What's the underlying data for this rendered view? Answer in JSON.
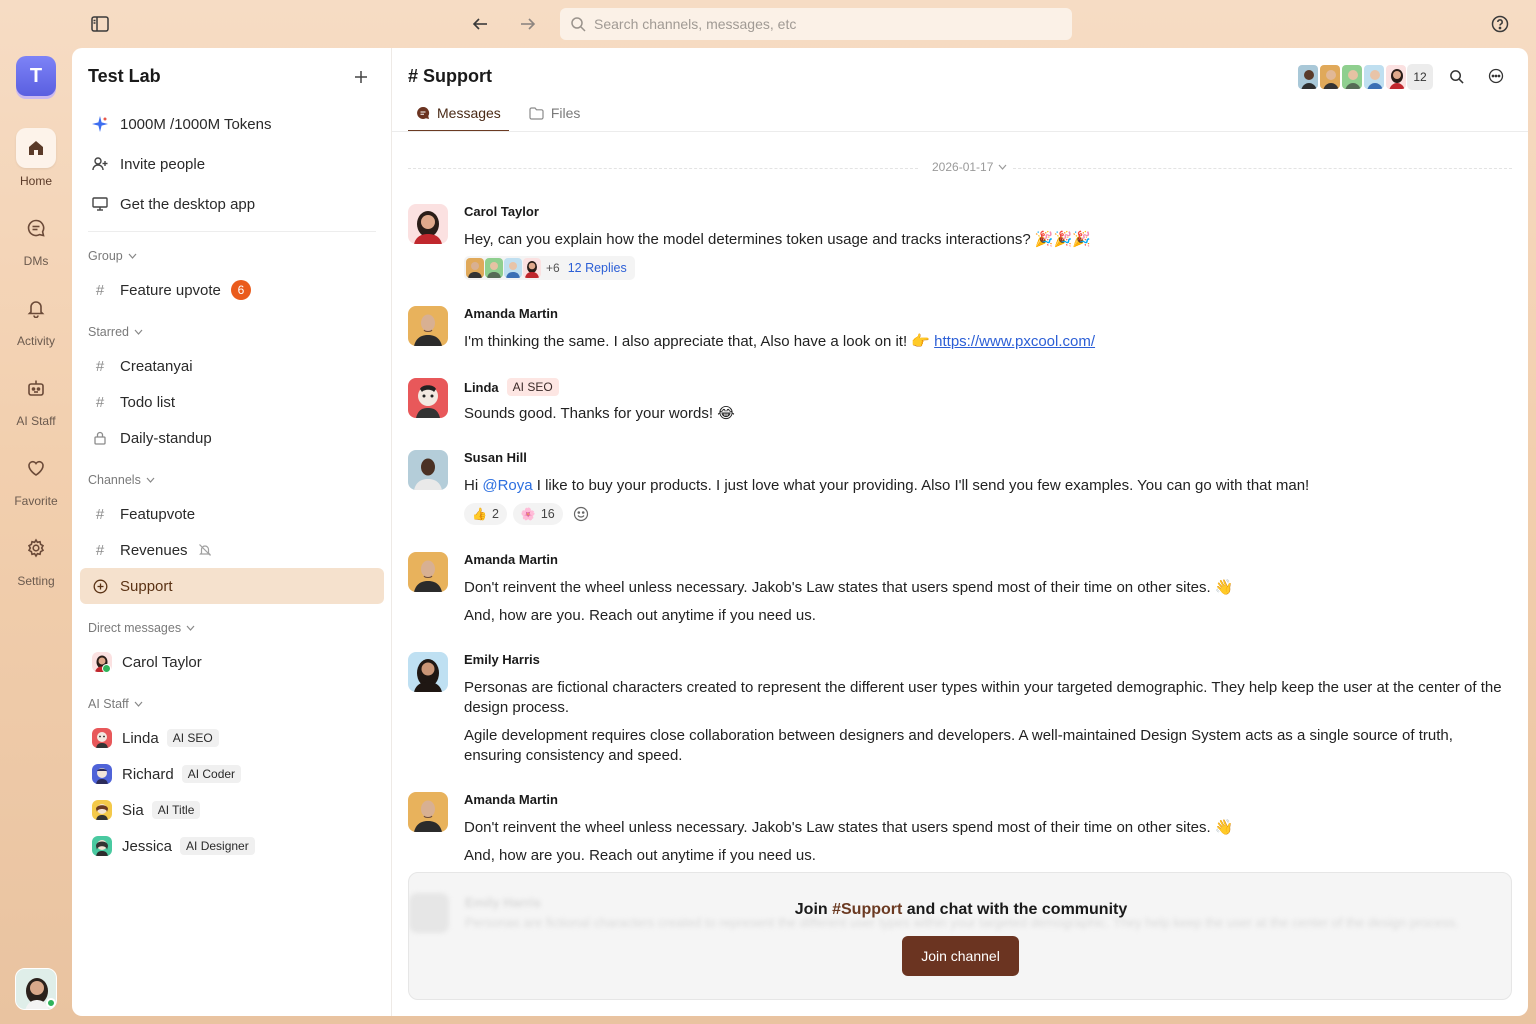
{
  "search": {
    "placeholder": "Search channels, messages, etc"
  },
  "rail": {
    "workspace_initial": "T",
    "items": [
      {
        "label": "Home",
        "icon": "home-icon"
      },
      {
        "label": "DMs",
        "icon": "chat-icon"
      },
      {
        "label": "Activity",
        "icon": "bell-icon"
      },
      {
        "label": "AI Staff",
        "icon": "robot-icon"
      },
      {
        "label": "Favorite",
        "icon": "heart-icon"
      },
      {
        "label": "Setting",
        "icon": "gear-icon"
      }
    ]
  },
  "sidebar": {
    "workspace_name": "Test Lab",
    "quick": [
      {
        "label": "1000M /1000M Tokens",
        "icon": "sparkle-icon"
      },
      {
        "label": "Invite people",
        "icon": "user-plus-icon"
      },
      {
        "label": "Get the desktop app",
        "icon": "monitor-icon"
      }
    ],
    "group_label": "Group",
    "group_items": [
      {
        "label": "Feature upvote",
        "count": "6"
      }
    ],
    "starred_label": "Starred",
    "starred_items": [
      {
        "label": "Creatanyai",
        "icon": "hash-icon"
      },
      {
        "label": "Todo list",
        "icon": "hash-icon"
      },
      {
        "label": "Daily-standup",
        "icon": "lock-icon"
      }
    ],
    "channels_label": "Channels",
    "channels": [
      {
        "label": "Featupvote",
        "icon": "hash-icon"
      },
      {
        "label": "Revenues",
        "icon": "hash-icon"
      },
      {
        "label": "Support",
        "icon": "plus-circle-icon"
      }
    ],
    "dm_label": "Direct messages",
    "dms": [
      {
        "label": "Carol Taylor"
      }
    ],
    "ai_label": "AI Staff",
    "ai_staff": [
      {
        "name": "Linda",
        "role": "AI SEO"
      },
      {
        "name": "Richard",
        "role": "AI Coder"
      },
      {
        "name": "Sia",
        "role": "AI Title"
      },
      {
        "name": "Jessica",
        "role": "AI Designer"
      }
    ]
  },
  "channel": {
    "title": "# Support",
    "member_count": "12",
    "tabs": [
      {
        "label": "Messages"
      },
      {
        "label": "Files"
      }
    ],
    "date": "2026-01-17"
  },
  "messages": [
    {
      "author": "Carol Taylor",
      "text": "Hey, can you explain how the model determines token usage and tracks interactions? 🎉🎉🎉",
      "replies_more": "+6",
      "replies_label": "12 Replies"
    },
    {
      "author": "Amanda Martin",
      "text": "I'm thinking the same. I also appreciate that, Also have a look on it! 👉",
      "link": "https://www.pxcool.com/"
    },
    {
      "author": "Linda",
      "role": "AI SEO",
      "text": "Sounds good. Thanks for your words! 😂"
    },
    {
      "author": "Susan Hill",
      "text_pre": "Hi ",
      "mention": "@Roya",
      "text_post": " I like to buy your products. I just love what your providing. Also I'll send you few examples. You can go with that man!",
      "reactions": [
        {
          "emoji": "👍",
          "count": "2"
        },
        {
          "emoji": "🌸",
          "count": "16"
        }
      ]
    },
    {
      "author": "Amanda Martin",
      "text": "Don't reinvent the wheel unless necessary. Jakob's Law states that users spend most of their time on other sites. 👋",
      "text2": "And, how are you. Reach out anytime if you need us."
    },
    {
      "author": "Emily Harris",
      "text": "Personas are fictional characters created to represent the different user types within your targeted demographic. They help keep the user at the center of the design process.",
      "text2": "Agile development requires close collaboration between designers and developers. A well-maintained Design System acts as a single source of truth, ensuring consistency and speed."
    },
    {
      "author": "Amanda Martin",
      "text": "Don't reinvent the wheel unless necessary. Jakob's Law states that users spend most of their time on other sites. 👋",
      "text2": "And, how are you. Reach out anytime if you need us."
    }
  ],
  "join": {
    "pre": "Join ",
    "channel": "#Support",
    "post": " and chat with the community",
    "button": "Join channel",
    "ghost_author": "Emily Harris",
    "ghost_text": "Personas are fictional characters created to represent the different user types within your targeted demographic. They help keep the user at the center of the design process."
  },
  "colors": {
    "accent": "#6b3421",
    "active_bg": "#f5e1cd",
    "badge": "#ea5b1c",
    "link": "#2c5fd6"
  }
}
